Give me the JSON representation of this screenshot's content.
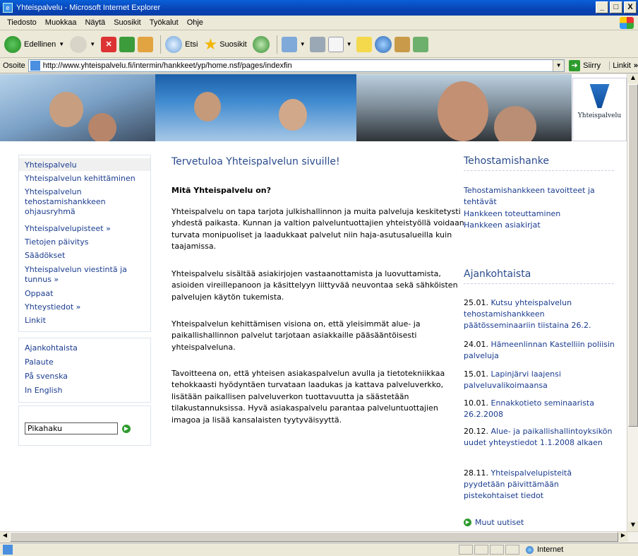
{
  "window": {
    "title": "Yhteispalvelu - Microsoft Internet Explorer",
    "min": "_",
    "max": "□",
    "close": "X"
  },
  "menu": [
    "Tiedosto",
    "Muokkaa",
    "Näytä",
    "Suosikit",
    "Työkalut",
    "Ohje"
  ],
  "toolbar": {
    "back": "Edellinen",
    "search": "Etsi",
    "favorites": "Suosikit"
  },
  "address": {
    "label": "Osoite",
    "url": "http://www.yhteispalvelu.fi/intermin/hankkeet/yp/home.nsf/pages/indexfin",
    "go": "Siirry",
    "links": "Linkit"
  },
  "logo": {
    "text": "Yhteispalvelu"
  },
  "nav": {
    "primary": [
      "Yhteispalvelu",
      "Yhteispalvelun kehittäminen",
      "Yhteispalvelun tehostamishankkeen ohjausryhmä",
      "Yhteispalvelupisteet »",
      "Tietojen päivitys",
      "Säädökset",
      "Yhteispalvelun viestintä ja tunnus »",
      "Oppaat",
      "Yhteystiedot »",
      "Linkit"
    ],
    "secondary": [
      "Ajankohtaista",
      "Palaute",
      "På svenska",
      "In English"
    ],
    "search_placeholder": "Pikahaku"
  },
  "main": {
    "title": "Tervetuloa Yhteispalvelun sivuille!",
    "heading": "Mitä Yhteispalvelu on?",
    "paragraphs": [
      "Yhteispalvelu on tapa tarjota julkishallinnon ja muita palveluja keskitetysti yhdestä paikasta. Kunnan ja valtion palveluntuottajien yhteistyöllä voidaan turvata monipuoliset ja laadukkaat palvelut niin haja-asutusalueilla kuin taajamissa.",
      "Yhteispalvelu sisältää asiakirjojen vastaanottamista ja luovuttamista, asioiden vireillepanoon ja käsittelyyn liittyvää neuvontaa sekä sähköisten palvelujen käytön tukemista.",
      "Yhteispalvelun kehittämisen visiona on, että yleisimmät alue- ja paikallishallinnon palvelut tarjotaan asiakkaille pääsääntöisesti yhteispalveluna.",
      "Tavoitteena on, että yhteisen asiakaspalvelun avulla ja tietotekniikkaa tehokkaasti hyödyntäen turvataan laadukas ja kattava palveluverkko, lisätään paikallisen palveluverkon tuottavuutta ja säästetään tilakustannuksissa. Hyvä asiakaspalvelu parantaa palveluntuottajien imagoa ja lisää kansalaisten tyytyväisyyttä."
    ]
  },
  "right": {
    "project_title": "Tehostamishanke",
    "project_links": [
      "Tehostamishankkeen tavoitteet ja tehtävät",
      "Hankkeen toteuttaminen",
      "Hankkeen asiakirjat"
    ],
    "news_title": "Ajankohtaista",
    "news": [
      {
        "date": "25.01.",
        "text": "Kutsu yhteispalvelun tehostamishankkeen päätösseminaariin tiistaina 26.2."
      },
      {
        "date": "24.01.",
        "text": "Hämeenlinnan Kastelliin poliisin palveluja"
      },
      {
        "date": "15.01.",
        "text": "Lapinjärvi laajensi palveluvalikoimaansa"
      },
      {
        "date": "10.01.",
        "text": "Ennakkotieto seminaarista 26.2.2008"
      },
      {
        "date": "20.12.",
        "text": "Alue- ja paikallishallintoyksikön uudet yhteystiedot 1.1.2008 alkaen"
      },
      {
        "date": "28.11.",
        "text": "Yhteispalvelupisteitä pyydetään päivittämään pistekohtaiset tiedot"
      }
    ],
    "more": "Muut uutiset"
  },
  "status": {
    "zone": "Internet"
  }
}
